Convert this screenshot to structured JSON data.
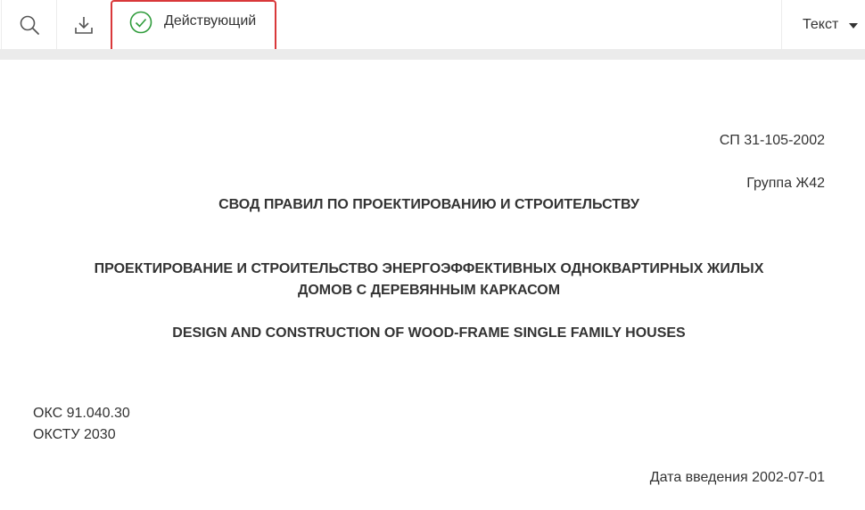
{
  "toolbar": {
    "search_icon": "search-icon",
    "download_icon": "download-icon",
    "status_icon": "check-circle-icon",
    "status_label": "Действующий",
    "status_color": "#2e9b3a",
    "highlight_color": "#d9383a",
    "view_label": "Текст"
  },
  "document": {
    "code": "СП 31-105-2002",
    "group": "Группа Ж42",
    "heading": "СВОД ПРАВИЛ ПО ПРОЕКТИРОВАНИЮ И СТРОИТЕЛЬСТВУ",
    "title_line1": "ПРОЕКТИРОВАНИЕ И СТРОИТЕЛЬСТВО ЭНЕРГОЭФФЕКТИВНЫХ ОДНОКВАРТИРНЫХ ЖИЛЫХ",
    "title_line2": "ДОМОВ С ДЕРЕВЯННЫМ КАРКАСОМ",
    "title_en": "DESIGN AND CONSTRUCTION OF WOOD-FRAME SINGLE FAMILY HOUSES",
    "oks": "ОКС 91.040.30",
    "okstu": "ОКСТУ 2030",
    "intro_date": "Дата введения 2002-07-01"
  }
}
